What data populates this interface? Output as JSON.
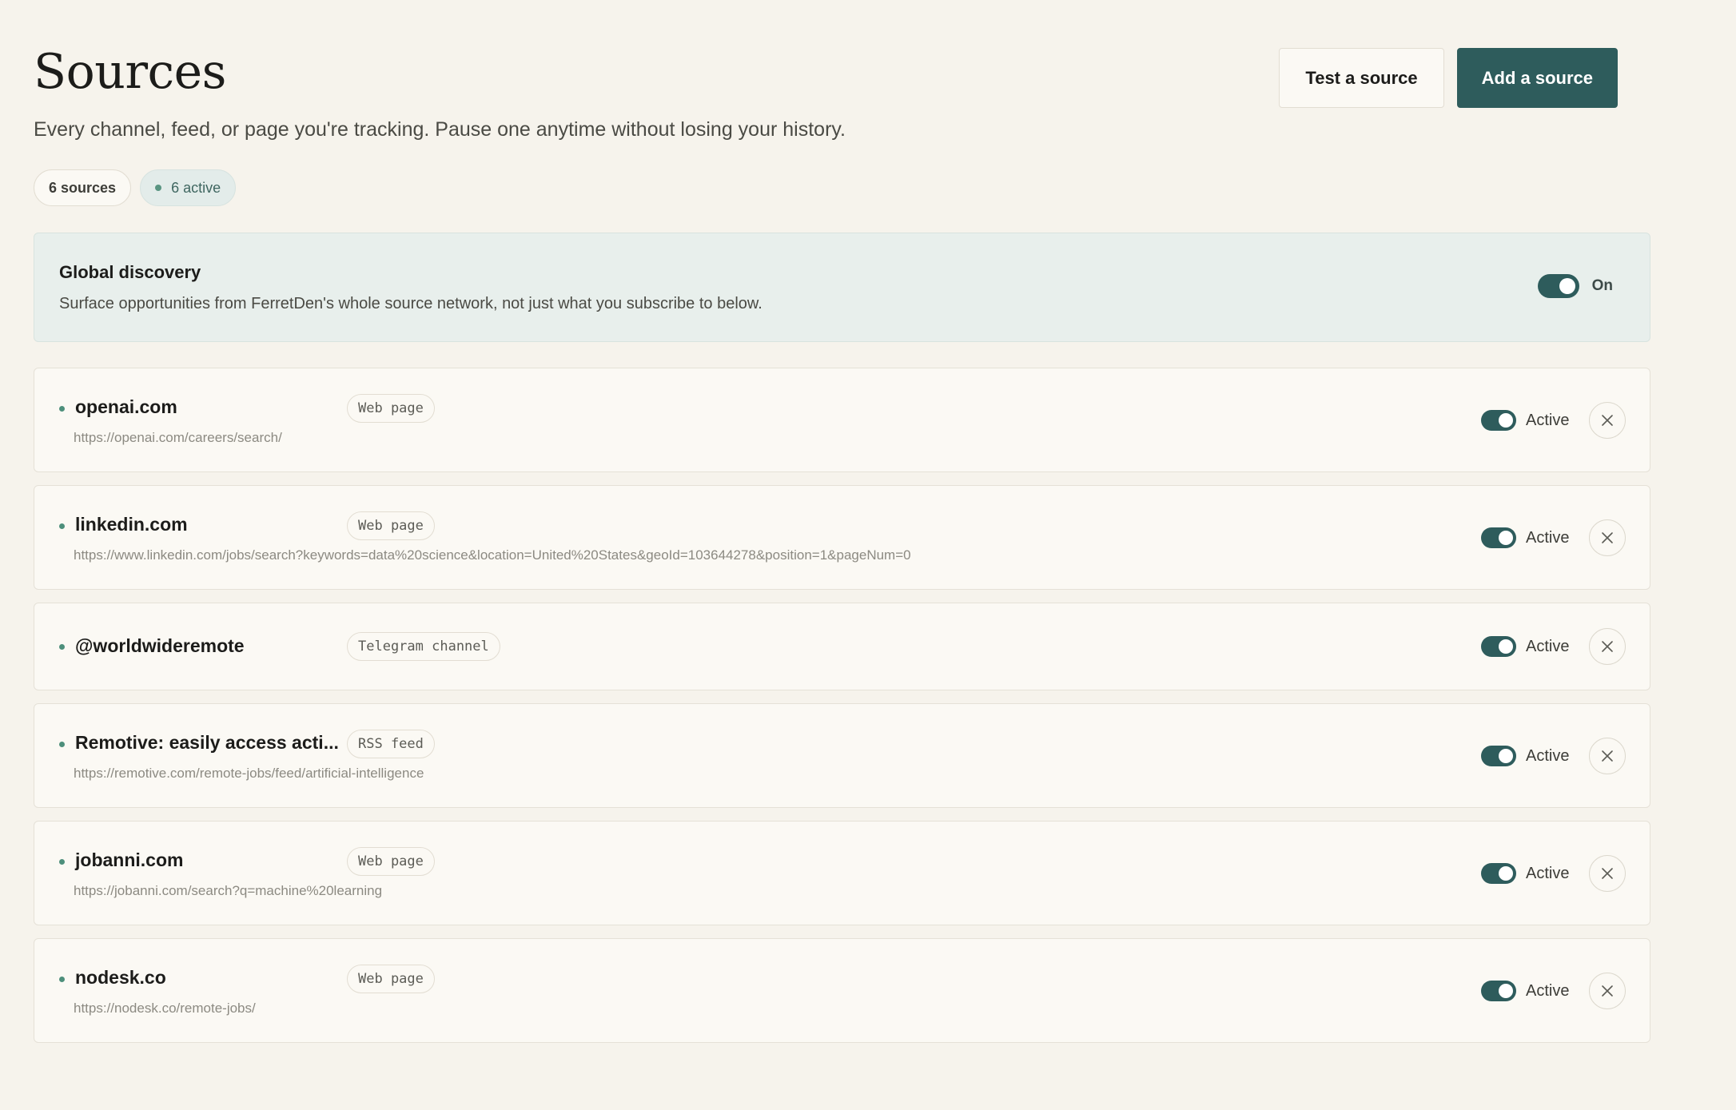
{
  "header": {
    "title": "Sources",
    "subtitle": "Every channel, feed, or page you're tracking. Pause one anytime without losing your history.",
    "test_button": "Test a source",
    "add_button": "Add a source"
  },
  "summary": {
    "count_label": "6 sources",
    "active_label": "6 active"
  },
  "discovery": {
    "title": "Global discovery",
    "description": "Surface opportunities from FerretDen's whole source network, not just what you subscribe to below.",
    "toggle_label": "On",
    "enabled": true
  },
  "sources": [
    {
      "name": "openai.com",
      "type": "Web page",
      "url": "https://openai.com/careers/search/",
      "status": "Active"
    },
    {
      "name": "linkedin.com",
      "type": "Web page",
      "url": "https://www.linkedin.com/jobs/search?keywords=data%20science&location=United%20States&geoId=103644278&position=1&pageNum=0",
      "status": "Active"
    },
    {
      "name": "@worldwideremote",
      "type": "Telegram channel",
      "url": "",
      "status": "Active"
    },
    {
      "name": "Remotive: easily access acti...",
      "type": "RSS feed",
      "url": "https://remotive.com/remote-jobs/feed/artificial-intelligence",
      "status": "Active"
    },
    {
      "name": "jobanni.com",
      "type": "Web page",
      "url": "https://jobanni.com/search?q=machine%20learning",
      "status": "Active"
    },
    {
      "name": "nodesk.co",
      "type": "Web page",
      "url": "https://nodesk.co/remote-jobs/",
      "status": "Active"
    }
  ],
  "icons": {
    "status_dot": "dot-icon",
    "remove": "close-icon"
  },
  "colors": {
    "accent": "#2e5c5c",
    "background": "#f6f3ec",
    "card": "#fbf9f4",
    "discovery_bg": "#e8efec",
    "status_dot": "#4d8f7b"
  }
}
